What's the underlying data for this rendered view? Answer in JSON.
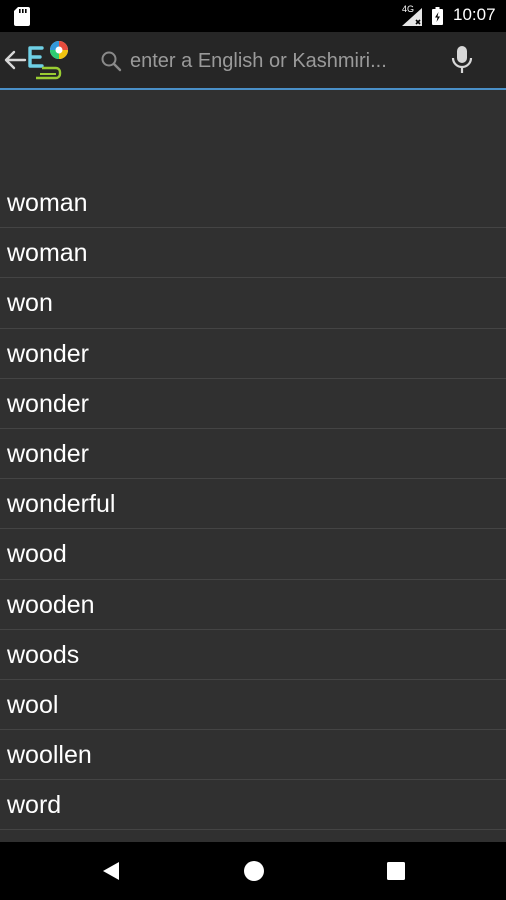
{
  "status_bar": {
    "network_label": "4G",
    "time": "10:07",
    "icons": [
      "sd-card-icon",
      "signal-icon",
      "battery-icon"
    ]
  },
  "toolbar": {
    "back_icon": "arrow-left-icon",
    "logo_icon": "app-logo-icon",
    "search": {
      "placeholder": "enter a English or Kashmiri...",
      "value": ""
    },
    "mic_icon": "microphone-icon",
    "accent_color": "#4a90c8"
  },
  "word_list": {
    "items": [
      {
        "label": "woman"
      },
      {
        "label": "woman"
      },
      {
        "label": "won"
      },
      {
        "label": "wonder"
      },
      {
        "label": "wonder"
      },
      {
        "label": "wonder"
      },
      {
        "label": "wonderful"
      },
      {
        "label": "wood"
      },
      {
        "label": "wooden"
      },
      {
        "label": "woods"
      },
      {
        "label": "wool"
      },
      {
        "label": "woollen"
      },
      {
        "label": "word"
      }
    ]
  },
  "nav_bar": {
    "icons": [
      "nav-back-icon",
      "nav-home-icon",
      "nav-recents-icon"
    ]
  },
  "colors": {
    "background": "#303030",
    "toolbar": "#262626",
    "text": "#ffffff",
    "divider": "#444444"
  }
}
